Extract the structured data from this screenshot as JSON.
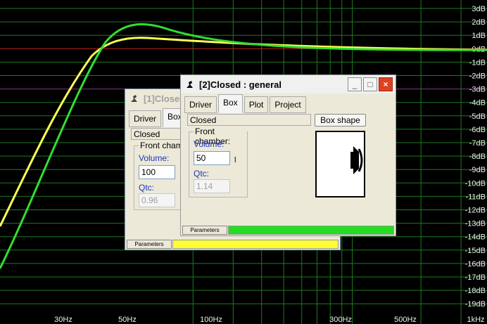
{
  "y_axis": {
    "labels": [
      "3dB",
      "2dB",
      "1dB",
      "0dB",
      "-1dB",
      "-2dB",
      "-3dB",
      "-4dB",
      "-5dB",
      "-6dB",
      "-7dB",
      "-8dB",
      "-9dB",
      "-10dB",
      "-11dB",
      "-12dB",
      "-13dB",
      "-14dB",
      "-15dB",
      "-16dB",
      "-17dB",
      "-18dB",
      "-19dB"
    ]
  },
  "x_axis": {
    "labels": [
      "30Hz",
      "50Hz",
      "100Hz",
      "300Hz",
      "500Hz",
      "1kHz"
    ]
  },
  "colors": {
    "grid": "#1f7a1f",
    "curve1": "#ffff55",
    "curve2": "#33dd33",
    "ref0": "#c02020",
    "ref3": "#8a2f8a"
  },
  "window1": {
    "title": "[1]Closed",
    "tabs": [
      "Driver",
      "Box"
    ],
    "active_tab": "Box",
    "box_type": "Closed",
    "group_label": "Front chamber:",
    "volume_label": "Volume:",
    "volume_value": "100",
    "qtc_label": "Qtc:",
    "qtc_value": "0.96",
    "status_label": "Parameters",
    "status_color": "#ffff33"
  },
  "window2": {
    "title": "[2]Closed : general",
    "tabs": [
      "Driver",
      "Box",
      "Plot",
      "Project"
    ],
    "active_tab": "Box",
    "box_type": "Closed",
    "box_shape_button": "Box shape",
    "group_label": "Front chamber:",
    "volume_label": "Volume:",
    "volume_value": "50",
    "volume_unit": "l",
    "qtc_label": "Qtc:",
    "qtc_value": "1.14",
    "status_label": "Parameters",
    "status_color": "#22dd22",
    "controls": {
      "minimize": "_",
      "maximize": "□",
      "close": "×"
    }
  }
}
